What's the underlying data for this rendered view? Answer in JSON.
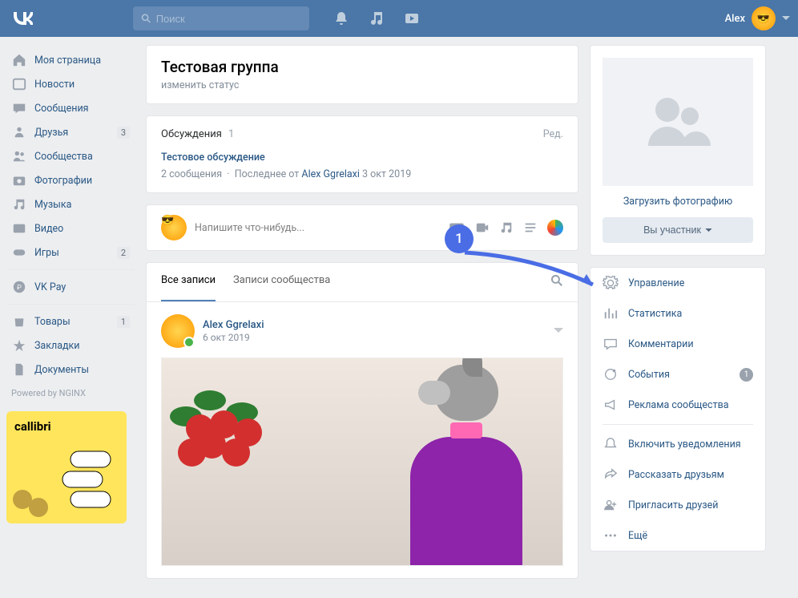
{
  "header": {
    "search_placeholder": "Поиск",
    "user_name": "Alex"
  },
  "sidebar": {
    "items": [
      {
        "label": "Моя страница",
        "icon": "home"
      },
      {
        "label": "Новости",
        "icon": "news"
      },
      {
        "label": "Сообщения",
        "icon": "msg"
      },
      {
        "label": "Друзья",
        "icon": "friends",
        "badge": "3"
      },
      {
        "label": "Сообщества",
        "icon": "groups"
      },
      {
        "label": "Фотографии",
        "icon": "photo"
      },
      {
        "label": "Музыка",
        "icon": "music"
      },
      {
        "label": "Видео",
        "icon": "video"
      },
      {
        "label": "Игры",
        "icon": "games",
        "badge": "2"
      }
    ],
    "vkpay": "VK Pay",
    "market": "Товары",
    "market_badge": "1",
    "bookmarks": "Закладки",
    "docs": "Документы",
    "powered": "Powered by NGINX",
    "promo": "callibri"
  },
  "group": {
    "title": "Тестовая группа",
    "status": "изменить статус"
  },
  "discussions": {
    "heading": "Обсуждения",
    "count": "1",
    "edit": "Ред.",
    "topic": "Тестовое обсуждение",
    "meta_msgs": "2 сообщения",
    "meta_dot": "·",
    "meta_last": "Последнее от",
    "meta_user": "Alex Ggrelaxi",
    "meta_date": "3 окт 2019"
  },
  "compose": {
    "placeholder": "Напишите что-нибудь..."
  },
  "tabs": {
    "all": "Все записи",
    "community": "Записи сообщества"
  },
  "post": {
    "author": "Alex Ggrelaxi",
    "date": "6 окт 2019"
  },
  "right": {
    "upload": "Загрузить фотографию",
    "member_btn": "Вы участник",
    "manage": [
      {
        "label": "Управление",
        "icon": "gear"
      },
      {
        "label": "Статистика",
        "icon": "stats"
      },
      {
        "label": "Комментарии",
        "icon": "comment"
      },
      {
        "label": "События",
        "icon": "events",
        "badge": "1"
      },
      {
        "label": "Реклама сообщества",
        "icon": "ads"
      }
    ],
    "actions": [
      {
        "label": "Включить уведомления",
        "icon": "bell"
      },
      {
        "label": "Рассказать друзьям",
        "icon": "share"
      },
      {
        "label": "Пригласить друзей",
        "icon": "invite"
      },
      {
        "label": "Ещё",
        "icon": "more"
      }
    ]
  },
  "annotation": {
    "num": "1"
  }
}
